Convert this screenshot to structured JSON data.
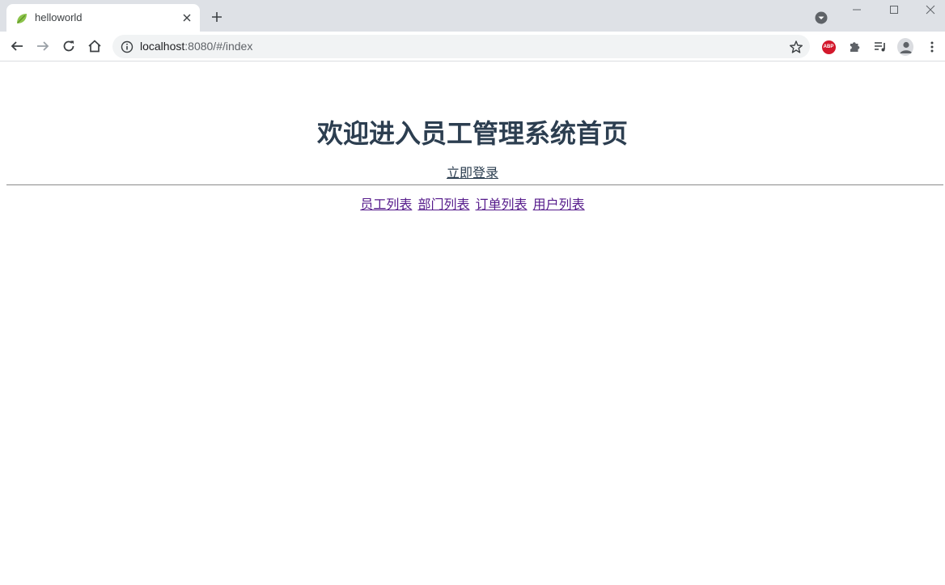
{
  "browser": {
    "tab_title": "helloworld",
    "url_host": "localhost",
    "url_rest": ":8080/#/index",
    "extensions": {
      "abp_label": "ABP"
    }
  },
  "page": {
    "title": "欢迎进入员工管理系统首页",
    "login_link": "立即登录",
    "nav": [
      {
        "label": "员工列表"
      },
      {
        "label": "部门列表"
      },
      {
        "label": "订单列表"
      },
      {
        "label": "用户列表"
      }
    ]
  },
  "colors": {
    "heading": "#2c3e50",
    "visited_link": "#551a8b",
    "tabstrip": "#dee1e6",
    "abp_red": "#d3182c"
  },
  "icons": [
    "leaf-favicon-icon",
    "close-icon",
    "plus-icon",
    "chevron-down-icon",
    "minimize-icon",
    "maximize-icon",
    "window-close-icon",
    "back-arrow-icon",
    "forward-arrow-icon",
    "reload-icon",
    "home-icon",
    "info-icon",
    "star-icon",
    "puzzle-icon",
    "media-queue-icon",
    "profile-icon",
    "kebab-menu-icon"
  ]
}
